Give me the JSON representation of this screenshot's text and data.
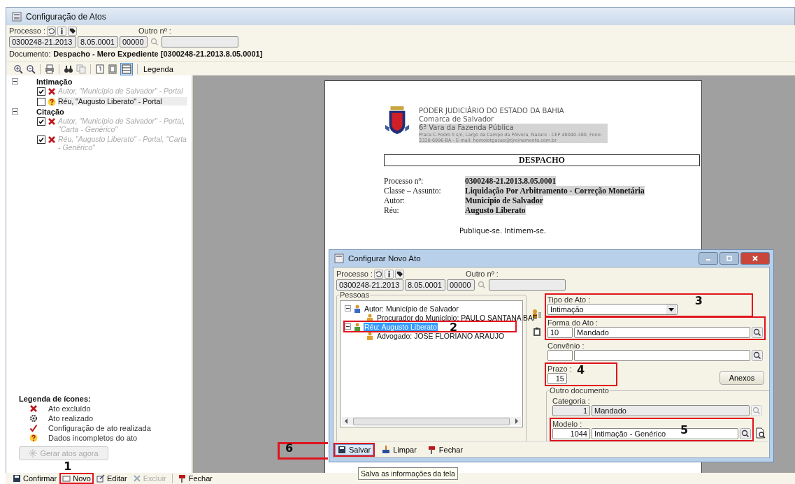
{
  "window": {
    "title": "Configuração de Atos"
  },
  "process": {
    "label": "Processo :",
    "number": "0300248-21.2013",
    "segment": "8.05.0001",
    "code": "00000",
    "other_label": "Outro nº :"
  },
  "document_line": {
    "label": "Documento:",
    "value": "Despacho - Mero Expediente [0300248-21.2013.8.05.0001]"
  },
  "toolbar": {
    "legend_button": "Legenda"
  },
  "tree": [
    {
      "label": "Intimação",
      "expanded": true,
      "children": [
        {
          "text": "Autor, \"Município de Salvador\" - Portal",
          "checked": true,
          "kind": "excluded",
          "selected": false
        },
        {
          "text": "Réu, \"Augusto Liberato\" - Portal",
          "checked": false,
          "kind": "incomplete",
          "selected": true
        }
      ]
    },
    {
      "label": "Citação",
      "expanded": true,
      "children": [
        {
          "text": "Autor, \"Município de Salvador\" - Portal, \"Carta - Genérico\"",
          "checked": true,
          "kind": "excluded",
          "selected": false
        },
        {
          "text": "Réu, \"Augusto Liberato\" - Portal, \"Carta - Genérico\"",
          "checked": true,
          "kind": "excluded",
          "selected": false
        }
      ]
    }
  ],
  "legend": {
    "title": "Legenda de ícones:",
    "items": [
      {
        "kind": "excluded",
        "text": "Ato excluído"
      },
      {
        "kind": "done",
        "text": "Ato realizado"
      },
      {
        "kind": "configured",
        "text": "Configuração de ato realizada"
      },
      {
        "kind": "incomplete",
        "text": "Dados incompletos do ato"
      }
    ]
  },
  "generate_button": {
    "label": "Gerar atos agora",
    "disabled": true
  },
  "bottom_toolbar": [
    {
      "label": "Confirmar",
      "disabled": false,
      "highlighted": false
    },
    {
      "label": "Novo",
      "disabled": false,
      "highlighted": true,
      "marker": "1"
    },
    {
      "label": "Editar",
      "disabled": false,
      "highlighted": false
    },
    {
      "label": "Excluir",
      "disabled": true,
      "highlighted": false
    },
    {
      "label": "Fechar",
      "disabled": false,
      "highlighted": false
    }
  ],
  "document": {
    "court": "PODER JUDICIÁRIO DO ESTADO DA BAHIA",
    "comarca": "Comarca de Salvador",
    "vara": "6ª Vara da Fazenda Pública",
    "address": "Praca C.Pedro II s/n, Largo da Campo da Pólvora, Nazare - CEP 40040-380, Fone: 3320-6996-BA - E-mail: homolotgacao@tjreinamento.com.br",
    "title": "DESPACHO",
    "fields": [
      {
        "label": "Processo nº:",
        "value": "0300248-21.2013.8.05.0001"
      },
      {
        "label": "Classe – Assunto:",
        "value": "Liquidação Por Arbitramento - Correção Monetária"
      },
      {
        "label": "Autor:",
        "value": "Município de Salvador"
      },
      {
        "label": "Réu:",
        "value": "Augusto Liberato"
      }
    ],
    "body": "Publique-se. Intimem-se."
  },
  "dialog": {
    "title": "Configurar Novo Ato",
    "process": {
      "label": "Processo :",
      "number": "0300248-21.2013",
      "segment": "8.05.0001",
      "code": "00000",
      "other_label": "Outro nº :"
    },
    "people_label": "Pessoas",
    "people": [
      {
        "text": "Autor: Município de Salvador",
        "selected": false,
        "highlighted": false,
        "children": [
          {
            "text": "Procurador do Município: PAULO SANTANA BAF",
            "selected": false
          }
        ]
      },
      {
        "text": "Réu: Augusto Liberato",
        "selected": true,
        "highlighted": true,
        "marker": "2",
        "children": [
          {
            "text": "Advogado: JOSE FLORIANO ARAUJO",
            "selected": false
          }
        ]
      }
    ],
    "tipo": {
      "label": "Tipo de Ato :",
      "value": "Intimação",
      "highlighted": true,
      "marker": "3"
    },
    "forma": {
      "label": "Forma do Ato :",
      "code": "10",
      "value": "Mandado",
      "highlighted": true
    },
    "convenio": {
      "label": "Convênio :",
      "highlighted": false
    },
    "prazo": {
      "label": "Prazo :",
      "value": "15",
      "highlighted": true,
      "marker": "4"
    },
    "anexos_button": "Anexos",
    "other_document": {
      "label": "Outro documento",
      "categoria": {
        "label": "Categoria :",
        "code": "1",
        "value": "Mandado",
        "highlighted": false
      },
      "modelo": {
        "label": "Modelo :",
        "code": "1044",
        "value": "Intimação - Genérico",
        "highlighted": true,
        "marker": "5"
      }
    },
    "actions": [
      {
        "label": "Salvar",
        "selected": true,
        "highlighted": true,
        "marker": "6"
      },
      {
        "label": "Limpar",
        "selected": false,
        "highlighted": false
      },
      {
        "label": "Fechar",
        "selected": false,
        "highlighted": false
      }
    ],
    "tooltip": "Salva as informações da tela"
  }
}
